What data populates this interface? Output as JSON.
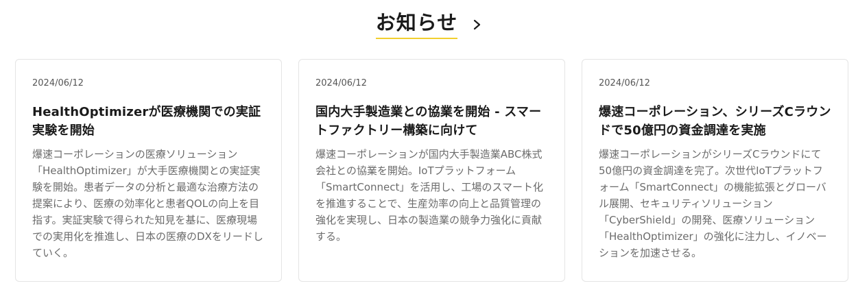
{
  "section": {
    "title": "お知らせ",
    "accent_color": "#f2cf2e",
    "link_icon": "chevron-right-icon"
  },
  "news": [
    {
      "date": "2024/06/12",
      "title": "HealthOptimizerが医療機関での実証実験を開始",
      "body": "爆速コーポレーションの医療ソリューション「HealthOptimizer」が大手医療機関との実証実験を開始。患者データの分析と最適な治療方法の提案により、医療の効率化と患者QOLの向上を目指す。実証実験で得られた知見を基に、医療現場での実用化を推進し、日本の医療のDXをリードしていく。"
    },
    {
      "date": "2024/06/12",
      "title": "国内大手製造業との協業を開始 - スマートファクトリー構築に向けて",
      "body": "爆速コーポレーションが国内大手製造業ABC株式会社との協業を開始。IoTプラットフォーム「SmartConnect」を活用し、工場のスマート化を推進することで、生産効率の向上と品質管理の強化を実現し、日本の製造業の競争力強化に貢献する。"
    },
    {
      "date": "2024/06/12",
      "title": "爆速コーポレーション、シリーズCラウンドで50億円の資金調達を実施",
      "body": "爆速コーポレーションがシリーズCラウンドにて50億円の資金調達を完了。次世代IoTプラットフォーム「SmartConnect」の機能拡張とグローバル展開、セキュリティソリューション「CyberShield」の開発、医療ソリューション「HealthOptimizer」の強化に注力し、イノベーションを加速させる。"
    }
  ]
}
